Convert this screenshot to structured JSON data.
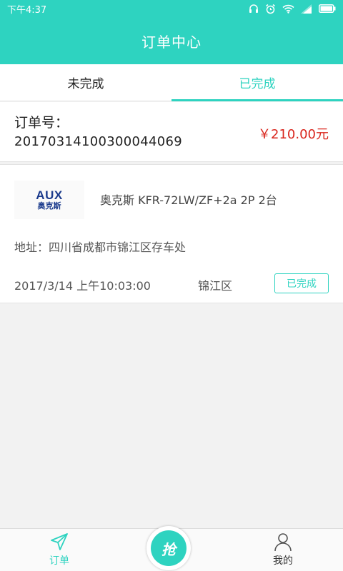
{
  "status_bar": {
    "time": "下午4:37",
    "icons": [
      "headphone-icon",
      "alarm-icon",
      "wifi-icon",
      "signal-icon",
      "battery-icon"
    ]
  },
  "header": {
    "title": "订单中心"
  },
  "tabs": [
    {
      "label": "未完成",
      "active": false
    },
    {
      "label": "已完成",
      "active": true
    }
  ],
  "order": {
    "number_label": "订单号：",
    "number": "20170314100300044069",
    "price": "￥210.00元",
    "brand_logo": {
      "en": "AUX",
      "cn": "奥克斯"
    },
    "product": "奥克斯 KFR-72LW/ZF+2a 2P 2台",
    "address": "地址：四川省成都市锦江区存车处",
    "time": "2017/3/14 上午10:03:00",
    "district": "锦江区",
    "status": "已完成"
  },
  "bottom_nav": {
    "orders_label": "订单",
    "grab_label": "抢",
    "mine_label": "我的"
  },
  "colors": {
    "accent": "#2ed3c0",
    "price": "#d9251c",
    "brand": "#1a3a8c"
  }
}
